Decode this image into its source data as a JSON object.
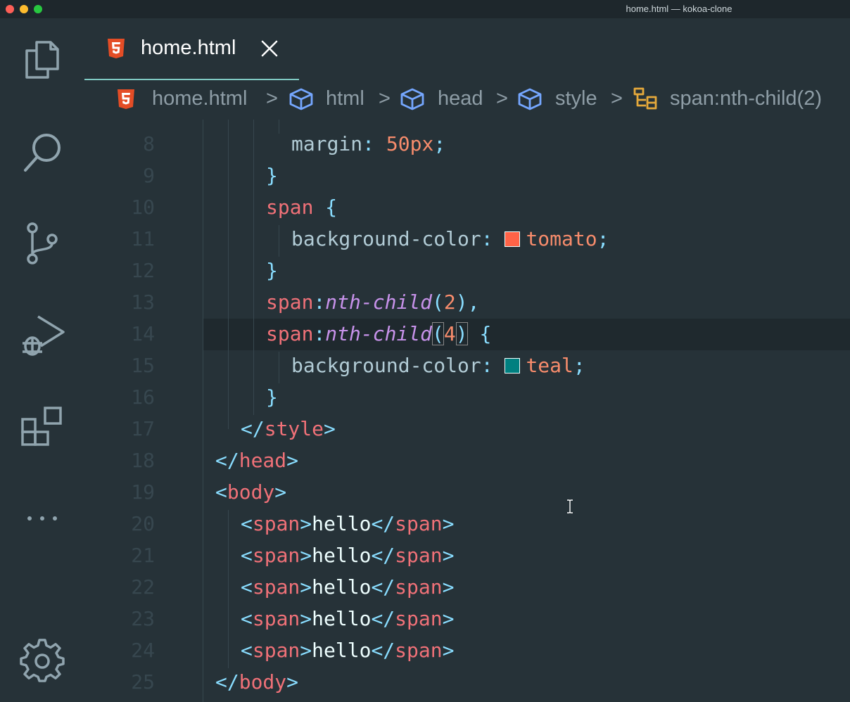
{
  "window": {
    "title": "home.html — kokoa-clone"
  },
  "activity_bar": {
    "items": [
      "explorer",
      "search",
      "source-control",
      "run-debug",
      "extensions",
      "more"
    ],
    "bottom": "settings"
  },
  "tab": {
    "label": "home.html"
  },
  "breadcrumb": {
    "items": [
      "home.html",
      "html",
      "head",
      "style",
      "span:nth-child(2)"
    ],
    "separator": ">"
  },
  "colors": {
    "tomato": "#ff6347",
    "teal": "#008080",
    "accent": "#80cbc4"
  },
  "editor": {
    "lines": [
      {
        "n": "8",
        "indent": 3,
        "tokens": [
          {
            "t": "margin",
            "c": "prop"
          },
          {
            "t": ": ",
            "c": "punc"
          },
          {
            "t": "50px",
            "c": "val"
          },
          {
            "t": ";",
            "c": "punc"
          }
        ]
      },
      {
        "n": "9",
        "indent": 2,
        "tokens": [
          {
            "t": "}",
            "c": "punc"
          }
        ]
      },
      {
        "n": "10",
        "indent": 2,
        "tokens": [
          {
            "t": "span",
            "c": "sel"
          },
          {
            "t": " {",
            "c": "punc"
          }
        ]
      },
      {
        "n": "11",
        "indent": 3,
        "tokens": [
          {
            "t": "background-color",
            "c": "prop"
          },
          {
            "t": ": ",
            "c": "punc"
          },
          {
            "swatch": "tomato"
          },
          {
            "t": "tomato",
            "c": "val"
          },
          {
            "t": ";",
            "c": "punc"
          }
        ]
      },
      {
        "n": "12",
        "indent": 2,
        "tokens": [
          {
            "t": "}",
            "c": "punc"
          }
        ]
      },
      {
        "n": "13",
        "indent": 2,
        "tokens": [
          {
            "t": "span",
            "c": "sel"
          },
          {
            "t": ":",
            "c": "punc"
          },
          {
            "t": "nth-child",
            "c": "pseudo"
          },
          {
            "t": "(",
            "c": "punc"
          },
          {
            "t": "2",
            "c": "val"
          },
          {
            "t": "),",
            "c": "punc"
          }
        ]
      },
      {
        "n": "14",
        "indent": 2,
        "tokens": [
          {
            "t": "span",
            "c": "sel"
          },
          {
            "t": ":",
            "c": "punc"
          },
          {
            "t": "nth-child",
            "c": "pseudo"
          },
          {
            "t": "(",
            "c": "punc",
            "m": true
          },
          {
            "t": "4",
            "c": "val"
          },
          {
            "t": ")",
            "c": "punc",
            "m": true
          },
          {
            "t": " {",
            "c": "punc"
          }
        ]
      },
      {
        "n": "15",
        "indent": 3,
        "tokens": [
          {
            "t": "background-color",
            "c": "prop"
          },
          {
            "t": ": ",
            "c": "punc"
          },
          {
            "swatch": "teal"
          },
          {
            "t": "teal",
            "c": "val"
          },
          {
            "t": ";",
            "c": "punc"
          }
        ]
      },
      {
        "n": "16",
        "indent": 2,
        "tokens": [
          {
            "t": "}",
            "c": "punc"
          }
        ]
      },
      {
        "n": "17",
        "indent": 1,
        "tokens": [
          {
            "t": "</",
            "c": "punc"
          },
          {
            "t": "style",
            "c": "tag"
          },
          {
            "t": ">",
            "c": "punc"
          }
        ]
      },
      {
        "n": "18",
        "indent": 0,
        "tokens": [
          {
            "t": "</",
            "c": "punc"
          },
          {
            "t": "head",
            "c": "tag"
          },
          {
            "t": ">",
            "c": "punc"
          }
        ]
      },
      {
        "n": "19",
        "indent": 0,
        "tokens": [
          {
            "t": "<",
            "c": "punc"
          },
          {
            "t": "body",
            "c": "tag"
          },
          {
            "t": ">",
            "c": "punc"
          }
        ]
      },
      {
        "n": "20",
        "indent": 1,
        "tokens": [
          {
            "t": "<",
            "c": "punc"
          },
          {
            "t": "span",
            "c": "tag"
          },
          {
            "t": ">",
            "c": "punc"
          },
          {
            "t": "hello",
            "c": "text"
          },
          {
            "t": "</",
            "c": "punc"
          },
          {
            "t": "span",
            "c": "tag"
          },
          {
            "t": ">",
            "c": "punc"
          }
        ]
      },
      {
        "n": "21",
        "indent": 1,
        "tokens": [
          {
            "t": "<",
            "c": "punc"
          },
          {
            "t": "span",
            "c": "tag"
          },
          {
            "t": ">",
            "c": "punc"
          },
          {
            "t": "hello",
            "c": "text"
          },
          {
            "t": "</",
            "c": "punc"
          },
          {
            "t": "span",
            "c": "tag"
          },
          {
            "t": ">",
            "c": "punc"
          }
        ]
      },
      {
        "n": "22",
        "indent": 1,
        "tokens": [
          {
            "t": "<",
            "c": "punc"
          },
          {
            "t": "span",
            "c": "tag"
          },
          {
            "t": ">",
            "c": "punc"
          },
          {
            "t": "hello",
            "c": "text"
          },
          {
            "t": "</",
            "c": "punc"
          },
          {
            "t": "span",
            "c": "tag"
          },
          {
            "t": ">",
            "c": "punc"
          }
        ]
      },
      {
        "n": "23",
        "indent": 1,
        "tokens": [
          {
            "t": "<",
            "c": "punc"
          },
          {
            "t": "span",
            "c": "tag"
          },
          {
            "t": ">",
            "c": "punc"
          },
          {
            "t": "hello",
            "c": "text"
          },
          {
            "t": "</",
            "c": "punc"
          },
          {
            "t": "span",
            "c": "tag"
          },
          {
            "t": ">",
            "c": "punc"
          }
        ]
      },
      {
        "n": "24",
        "indent": 1,
        "tokens": [
          {
            "t": "<",
            "c": "punc"
          },
          {
            "t": "span",
            "c": "tag"
          },
          {
            "t": ">",
            "c": "punc"
          },
          {
            "t": "hello",
            "c": "text"
          },
          {
            "t": "</",
            "c": "punc"
          },
          {
            "t": "span",
            "c": "tag"
          },
          {
            "t": ">",
            "c": "punc"
          }
        ]
      },
      {
        "n": "25",
        "indent": 0,
        "tokens": [
          {
            "t": "</",
            "c": "punc"
          },
          {
            "t": "body",
            "c": "tag"
          },
          {
            "t": ">",
            "c": "punc"
          }
        ]
      }
    ]
  }
}
